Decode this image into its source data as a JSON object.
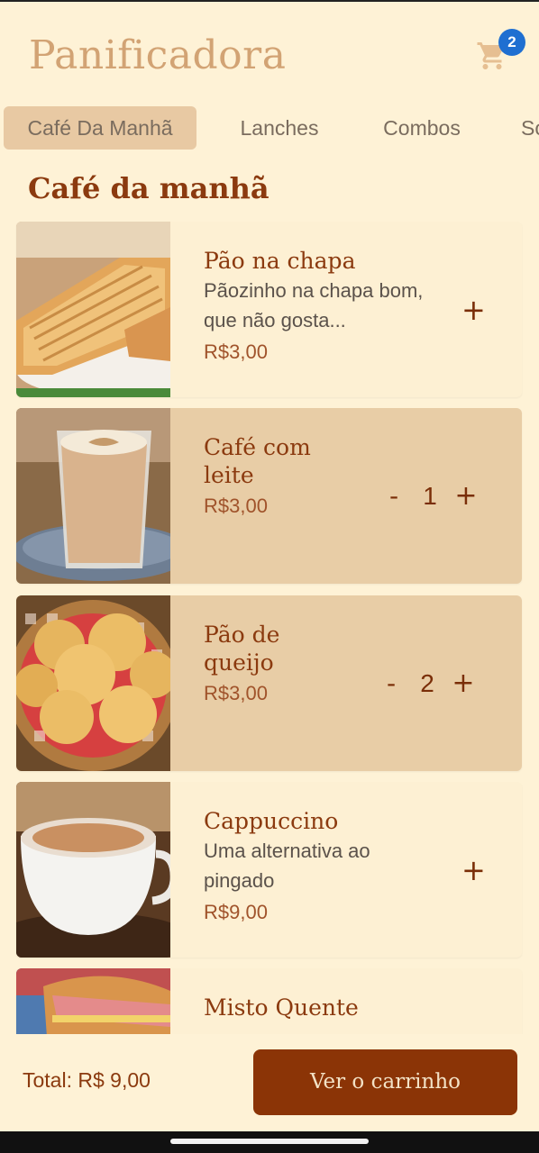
{
  "app": {
    "title": "Panificadora",
    "cart_count": "2"
  },
  "tabs": [
    {
      "label": "Café Da Manhã",
      "active": true
    },
    {
      "label": "Lanches",
      "active": false
    },
    {
      "label": "Combos",
      "active": false
    },
    {
      "label": "Sobremesas",
      "active": false
    }
  ],
  "section_title": "Café da manhã",
  "products": [
    {
      "name": "Pão na chapa",
      "desc": "Pãozinho na chapa bom, que não gosta...",
      "price": "R$3,00",
      "add": "+"
    },
    {
      "name": "Café com leite",
      "price": "R$3,00",
      "qty": "1",
      "minus": "-",
      "plus": "+"
    },
    {
      "name": "Pão de queijo",
      "price": "R$3,00",
      "qty": "2",
      "minus": "-",
      "plus": "+"
    },
    {
      "name": "Cappuccino",
      "desc": "Uma alternativa ao pingado",
      "price": "R$9,00",
      "add": "+"
    },
    {
      "name": "Misto Quente"
    }
  ],
  "footer": {
    "total": "Total: R$ 9,00",
    "cta": "Ver o carrinho"
  },
  "colors": {
    "accent": "#8b3a0f",
    "background": "#fef2d6",
    "selected": "#e8cda6",
    "badge": "#1f6fd1"
  }
}
